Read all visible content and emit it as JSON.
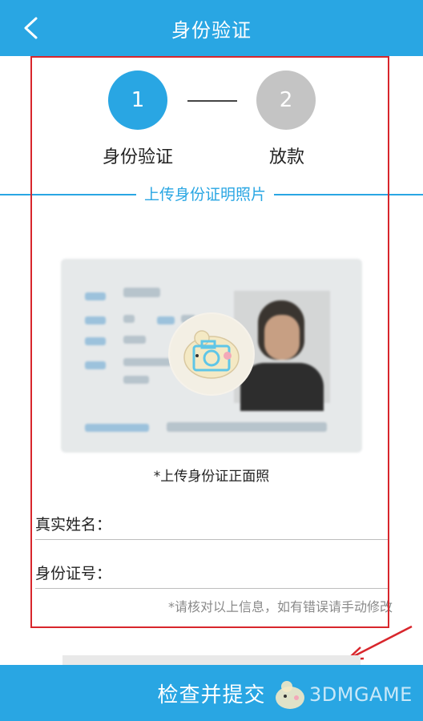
{
  "header": {
    "title": "身份验证",
    "back_icon": "chevron-left-icon"
  },
  "steps": [
    {
      "number": "1",
      "label": "身份验证",
      "state": "active",
      "color": "#29a6e3"
    },
    {
      "number": "2",
      "label": "放款",
      "state": "inactive",
      "color": "#c4c4c4"
    }
  ],
  "section": {
    "title": "上传身份证明照片"
  },
  "upload": {
    "caption": "*上传身份证正面照",
    "icon": "camera-icon"
  },
  "form": {
    "name_label": "真实姓名：",
    "name_value": "",
    "id_label": "身份证号：",
    "id_value": "",
    "hint": "*请核对以上信息，如有错误请手动修改"
  },
  "submit": {
    "label": "检查并提交"
  },
  "watermark": {
    "text": "3DMGAME"
  },
  "colors": {
    "accent": "#29a6e3",
    "annotation": "#d8262c"
  }
}
